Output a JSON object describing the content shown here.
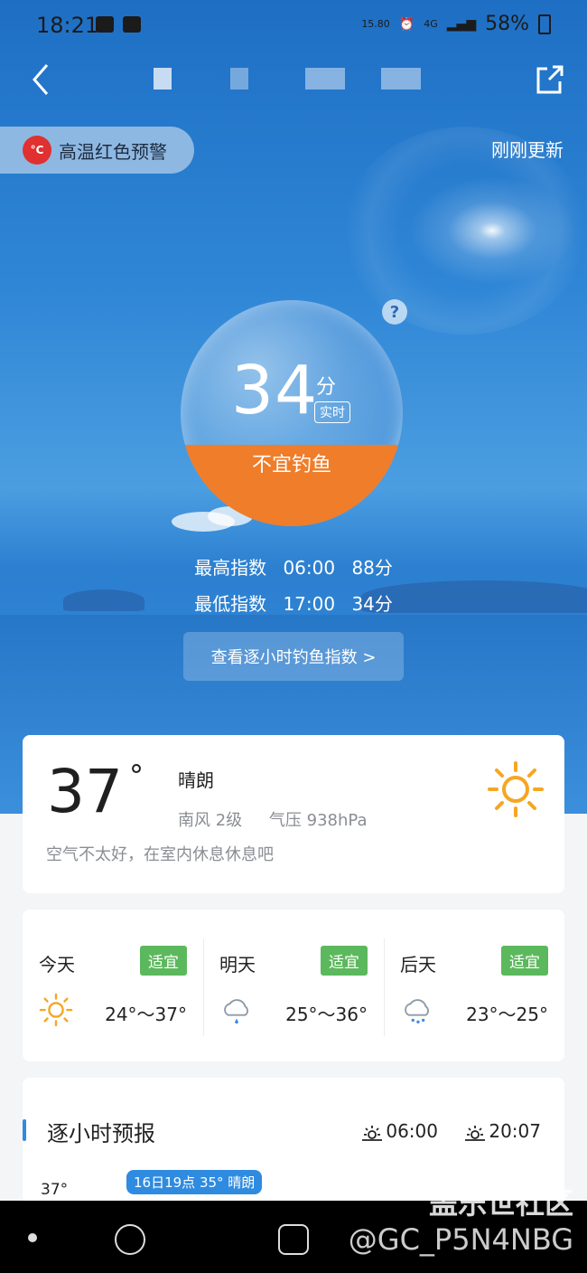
{
  "status_bar": {
    "time": "18:21",
    "net_speed": "15.80",
    "network": "4G",
    "battery": "58%"
  },
  "header": {
    "back_icon": "chevron-left-icon",
    "share_icon": "share-icon"
  },
  "alert": {
    "text": "高温红色预警",
    "icon_text": "°C"
  },
  "updated": "刚刚更新",
  "fishing": {
    "score": "34",
    "unit": "分",
    "badge": "实时",
    "verdict": "不宜钓鱼",
    "help": "?",
    "highest": {
      "label": "最高指数",
      "time": "06:00",
      "value": "88分"
    },
    "lowest": {
      "label": "最低指数",
      "time": "17:00",
      "value": "34分"
    },
    "hourly_button": "查看逐小时钓鱼指数 >"
  },
  "current": {
    "temp": "37",
    "deg": "°",
    "condition": "晴朗",
    "wind": "南风  2级",
    "pressure": "气压  938hPa",
    "advice": "空气不太好，在室内休息休息吧"
  },
  "forecast": [
    {
      "day": "今天",
      "tag": "适宜",
      "icon": "sun-icon",
      "range": "24°～37°"
    },
    {
      "day": "明天",
      "tag": "适宜",
      "icon": "rain-cloud-icon",
      "range": "25°～36°"
    },
    {
      "day": "后天",
      "tag": "适宜",
      "icon": "rain-cloud-icon",
      "range": "23°～25°"
    }
  ],
  "hourly": {
    "title": "逐小时预报",
    "sunrise": "06:00",
    "sunset": "20:07",
    "high_label": "37°",
    "tooltip": "16日19点 35° 晴朗"
  },
  "watermark": {
    "line1": "盖乐世社区",
    "line2": "@GC_P5N4NBG"
  },
  "colors": {
    "accent": "#2f8be0",
    "orange": "#ef7d2a",
    "green": "#5cb85c",
    "alert_red": "#e0302f"
  }
}
